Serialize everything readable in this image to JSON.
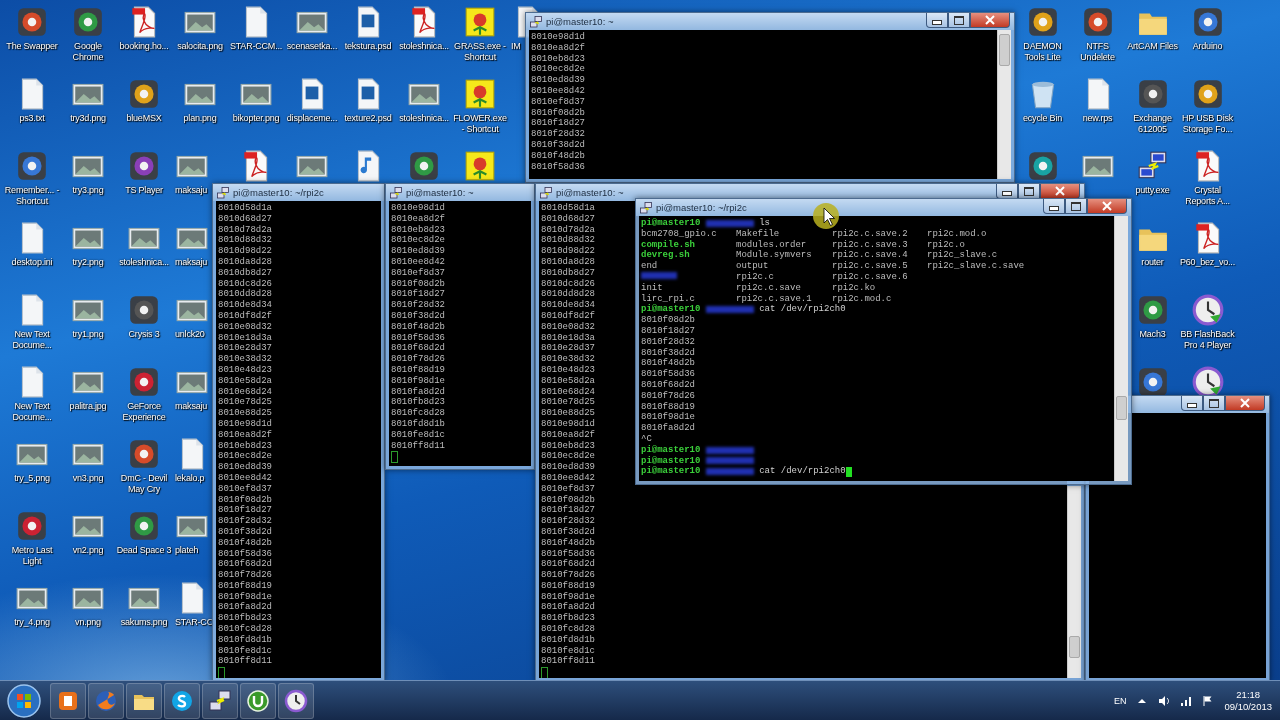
{
  "desktop": {
    "left_columns": [
      {
        "icons": [
          {
            "label": "The Swapper",
            "kind": "app"
          },
          {
            "label": "ps3.txt",
            "kind": "document"
          },
          {
            "label": "Remember... - Shortcut",
            "kind": "app"
          },
          {
            "label": "desktop.ini",
            "kind": "document"
          },
          {
            "label": "New Text Docume...",
            "kind": "document"
          },
          {
            "label": "New Text Docume...",
            "kind": "document"
          },
          {
            "label": "try_5.png",
            "kind": "image"
          },
          {
            "label": "Metro Last Light",
            "kind": "app"
          },
          {
            "label": "try_4.png",
            "kind": "image"
          }
        ]
      },
      {
        "icons": [
          {
            "label": "Google Chrome",
            "kind": "app"
          },
          {
            "label": "try3d.png",
            "kind": "image"
          },
          {
            "label": "try3.png",
            "kind": "image"
          },
          {
            "label": "try2.png",
            "kind": "image"
          },
          {
            "label": "try1.png",
            "kind": "image"
          },
          {
            "label": "palitra.jpg",
            "kind": "image"
          },
          {
            "label": "vn3.png",
            "kind": "image"
          },
          {
            "label": "vn2.png",
            "kind": "image"
          },
          {
            "label": "vn.png",
            "kind": "image"
          }
        ]
      },
      {
        "icons": [
          {
            "label": "booking.ho...",
            "kind": "pdf"
          },
          {
            "label": "blueMSX",
            "kind": "app"
          },
          {
            "label": "TS Player",
            "kind": "app"
          },
          {
            "label": "stoleshnica...",
            "kind": "image"
          },
          {
            "label": "Crysis 3",
            "kind": "app"
          },
          {
            "label": "GeForce Experience",
            "kind": "app"
          },
          {
            "label": "DmC - Devil May Cry",
            "kind": "app"
          },
          {
            "label": "Dead Space 3",
            "kind": "app"
          },
          {
            "label": "sakums.png",
            "kind": "image"
          }
        ]
      },
      {
        "icons": [
          {
            "label": "salocita.png",
            "kind": "image"
          },
          {
            "label": "plan.png",
            "kind": "image"
          },
          {
            "label": "maksaju",
            "kind": "image"
          },
          {
            "label": "maksaju",
            "kind": "image"
          },
          {
            "label": "unlck20",
            "kind": "image"
          },
          {
            "label": "maksaju",
            "kind": "image"
          },
          {
            "label": "lekalo.p",
            "kind": "document"
          },
          {
            "label": "plateh",
            "kind": "image"
          },
          {
            "label": "STAR-CC",
            "kind": "document"
          }
        ]
      },
      {
        "icons": [
          {
            "label": "STAR-CCM...",
            "kind": "document"
          },
          {
            "label": "bikopter.png",
            "kind": "image"
          },
          {
            "kind": "pdf"
          }
        ]
      },
      {
        "icons": [
          {
            "label": "scenasetka...",
            "kind": "image"
          },
          {
            "label": "displaceme...",
            "kind": "psd"
          },
          {
            "kind": "image"
          }
        ]
      },
      {
        "icons": [
          {
            "label": "tekstura.psd",
            "kind": "psd"
          },
          {
            "label": "texture2.psd",
            "kind": "psd"
          },
          {
            "kind": "music"
          }
        ]
      },
      {
        "icons": [
          {
            "label": "stoleshnica...",
            "kind": "pdf"
          },
          {
            "label": "stoleshnica...",
            "kind": "image"
          },
          {
            "kind": "app"
          }
        ]
      },
      {
        "icons": [
          {
            "label": "GRASS.exe - Shortcut",
            "kind": "square_app"
          },
          {
            "label": "FLOWER.exe - Shortcut",
            "kind": "square_app"
          },
          {
            "kind": "square_app"
          }
        ]
      },
      {
        "icons": [
          {
            "label": "IM",
            "kind": "document"
          }
        ]
      }
    ],
    "right_columns": [
      {
        "icons": [
          {
            "label": "DAEMON Tools Lite",
            "kind": "app"
          },
          {
            "label": "ecycle Bin",
            "kind": "recycle"
          },
          {
            "kind": "app"
          }
        ]
      },
      {
        "icons": [
          {
            "label": "NTFS Undelete",
            "kind": "app"
          },
          {
            "label": "new.rps",
            "kind": "document"
          },
          {
            "kind": "image"
          }
        ]
      },
      {
        "icons": [
          {
            "label": "ArtCAM Files",
            "kind": "folder"
          },
          {
            "label": "Exchange 612005",
            "kind": "app"
          },
          {
            "label": "putty.exe",
            "kind": "network"
          },
          {
            "label": "router",
            "kind": "folder"
          },
          {
            "label": "Mach3",
            "kind": "app"
          },
          {
            "kind": "app"
          }
        ]
      },
      {
        "icons": [
          {
            "label": "Arduino",
            "kind": "app"
          },
          {
            "label": "HP USB Disk Storage Fo...",
            "kind": "app"
          },
          {
            "label": "Crystal Reports A...",
            "kind": "pdf"
          },
          {
            "label": "P60_bez_vo...",
            "kind": "pdf"
          },
          {
            "label": "BB FlashBack Pro 4 Player",
            "kind": "clock"
          },
          {
            "kind": "clock"
          }
        ]
      }
    ]
  },
  "windows": [
    {
      "title": "pi@master10: ~",
      "controls_visible": true,
      "scrollbar_visible": true,
      "cursor_visible": false,
      "lines": [
        "8010e98d1d",
        "8010ea8d2f",
        "8010eb8d23",
        "8010ec8d2e",
        "8010ed8d39",
        "8010ee8d42",
        "8010ef8d37",
        "8010f08d2b",
        "8010f18d27",
        "8010f28d32",
        "8010f38d2d",
        "8010f48d2b",
        "8010f58d36"
      ]
    },
    {
      "title": "pi@master10: ~/rpi2c",
      "controls_visible": false,
      "scrollbar_visible": false,
      "cursor_visible": true,
      "lines": [
        "8010d58d1a",
        "8010d68d27",
        "8010d78d2a",
        "8010d88d32",
        "8010d98d22",
        "8010da8d28",
        "8010db8d27",
        "8010dc8d26",
        "8010dd8d28",
        "8010de8d34",
        "8010df8d2f",
        "8010e08d32",
        "8010e18d3a",
        "8010e28d37",
        "8010e38d32",
        "8010e48d23",
        "8010e58d2a",
        "8010e68d24",
        "8010e78d25",
        "8010e88d25",
        "8010e98d1d",
        "8010ea8d2f",
        "8010eb8d23",
        "8010ec8d2e",
        "8010ed8d39",
        "8010ee8d42",
        "8010ef8d37",
        "8010f08d2b",
        "8010f18d27",
        "8010f28d32",
        "8010f38d2d",
        "8010f48d2b",
        "8010f58d36",
        "8010f68d2d",
        "8010f78d26",
        "8010f88d19",
        "8010f98d1e",
        "8010fa8d2d",
        "8010fb8d23",
        "8010fc8d28",
        "8010fd8d1b",
        "8010fe8d1c",
        "8010ff8d11"
      ]
    },
    {
      "title": "pi@master10: ~",
      "controls_visible": false,
      "scrollbar_visible": false,
      "cursor_visible": true,
      "lines": [
        "8010e98d1d",
        "8010ea8d2f",
        "8010eb8d23",
        "8010ec8d2e",
        "8010ed8d39",
        "8010ee8d42",
        "8010ef8d37",
        "8010f08d2b",
        "8010f18d27",
        "8010f28d32",
        "8010f38d2d",
        "8010f48d2b",
        "8010f58d36",
        "8010f68d2d",
        "8010f78d26",
        "8010f88d19",
        "8010f98d1e",
        "8010fa8d2d",
        "8010fb8d23",
        "8010fc8d28",
        "8010fd8d1b",
        "8010fe8d1c",
        "8010ff8d11"
      ]
    },
    {
      "title": "pi@master10: ~",
      "controls_visible": true,
      "scrollbar_visible": true,
      "cursor_visible": true,
      "lines": [
        "8010d58d1a",
        "8010d68d27",
        "8010d78d2a",
        "8010d88d32",
        "8010d98d22",
        "8010da8d28",
        "8010db8d27",
        "8010dc8d26",
        "8010dd8d28",
        "8010de8d34",
        "8010df8d2f",
        "8010e08d32",
        "8010e18d3a",
        "8010e28d37",
        "8010e38d32",
        "8010e48d23",
        "8010e58d2a",
        "8010e68d24",
        "8010e78d25",
        "8010e88d25",
        "8010e98d1d",
        "8010ea8d2f",
        "8010eb8d23",
        "8010ec8d2e",
        "8010ed8d39",
        "8010ee8d42",
        "8010ef8d37",
        "8010f08d2b",
        "8010f18d27",
        "8010f28d32",
        "8010f38d2d",
        "8010f48d2b",
        "8010f58d36",
        "8010f68d2d",
        "8010f78d26",
        "8010f88d19",
        "8010f98d1e",
        "8010fa8d2d",
        "8010fb8d23",
        "8010fc8d28",
        "8010fd8d1b",
        "8010fe8d1c",
        "8010ff8d11"
      ]
    },
    {
      "controls_visible": true,
      "scrollbar_visible": false,
      "cursor_visible": false
    },
    {
      "title": "pi@master10: ~/rpi2c",
      "controls_visible": true,
      "scrollbar_visible": true,
      "cursor_visible": true,
      "session": [
        {
          "kind": "prompt",
          "user": "pi@master10",
          "command": "ls"
        },
        {
          "kind": "ls_row",
          "cells": [
            {
              "text": "bcm2708_gpio.c",
              "kind": "file"
            },
            {
              "text": "Makefile",
              "kind": "file"
            },
            {
              "text": "rpi2c.c.save.2",
              "kind": "file"
            },
            {
              "text": "rpi2c.mod.o",
              "kind": "file"
            }
          ]
        },
        {
          "kind": "ls_row",
          "cells": [
            {
              "text": "compile.sh",
              "kind": "exec"
            },
            {
              "text": "modules.order",
              "kind": "file"
            },
            {
              "text": "rpi2c.c.save.3",
              "kind": "file"
            },
            {
              "text": "rpi2c.o",
              "kind": "file"
            }
          ]
        },
        {
          "kind": "ls_row",
          "cells": [
            {
              "text": "devreg.sh",
              "kind": "exec"
            },
            {
              "text": "Module.symvers",
              "kind": "file"
            },
            {
              "text": "rpi2c.c.save.4",
              "kind": "file"
            },
            {
              "text": "rpi2c_slave.c",
              "kind": "file"
            }
          ]
        },
        {
          "kind": "ls_row",
          "cells": [
            {
              "text": "end",
              "kind": "file"
            },
            {
              "text": "output",
              "kind": "file"
            },
            {
              "text": "rpi2c.c.save.5",
              "kind": "file"
            },
            {
              "text": "rpi2c_slave.c.save",
              "kind": "file"
            }
          ]
        },
        {
          "kind": "ls_row",
          "cells": [
            {
              "kind": "blurred"
            },
            {
              "text": "rpi2c.c",
              "kind": "file"
            },
            {
              "text": "rpi2c.c.save.6",
              "kind": "file"
            }
          ]
        },
        {
          "kind": "ls_row",
          "cells": [
            {
              "text": "init",
              "kind": "file"
            },
            {
              "text": "rpi2c.c.save",
              "kind": "file"
            },
            {
              "text": "rpi2c.ko",
              "kind": "file"
            }
          ]
        },
        {
          "kind": "ls_row",
          "cells": [
            {
              "text": "lirc_rpi.c",
              "kind": "file"
            },
            {
              "text": "rpi2c.c.save.1",
              "kind": "file"
            },
            {
              "text": "rpi2c.mod.c",
              "kind": "file"
            }
          ]
        },
        {
          "kind": "prompt",
          "user": "pi@master10",
          "command": "cat /dev/rpi2ch0"
        },
        {
          "kind": "output",
          "text": "8010f08d2b"
        },
        {
          "kind": "output",
          "text": "8010f18d27"
        },
        {
          "kind": "output",
          "text": "8010f28d32"
        },
        {
          "kind": "output",
          "text": "8010f38d2d"
        },
        {
          "kind": "output",
          "text": "8010f48d2b"
        },
        {
          "kind": "output",
          "text": "8010f58d36"
        },
        {
          "kind": "output",
          "text": "8010f68d2d"
        },
        {
          "kind": "output",
          "text": "8010f78d26"
        },
        {
          "kind": "output",
          "text": "8010f88d19"
        },
        {
          "kind": "output",
          "text": "8010f98d1e"
        },
        {
          "kind": "output",
          "text": "8010fa8d2d"
        },
        {
          "kind": "output",
          "text": "^C"
        },
        {
          "kind": "prompt",
          "user": "pi@master10"
        },
        {
          "kind": "prompt",
          "user": "pi@master10"
        },
        {
          "kind": "prompt",
          "user": "pi@master10",
          "command": "cat /dev/rpi2ch0"
        }
      ]
    }
  ],
  "taskbar": {
    "pinned": [
      {
        "kind": "media"
      },
      {
        "kind": "browser"
      },
      {
        "kind": "folder"
      },
      {
        "kind": "chat"
      },
      {
        "kind": "network"
      },
      {
        "kind": "torrent"
      },
      {
        "kind": "clock"
      }
    ],
    "language": "EN",
    "time": "21:18",
    "date": "09/10/2013"
  }
}
